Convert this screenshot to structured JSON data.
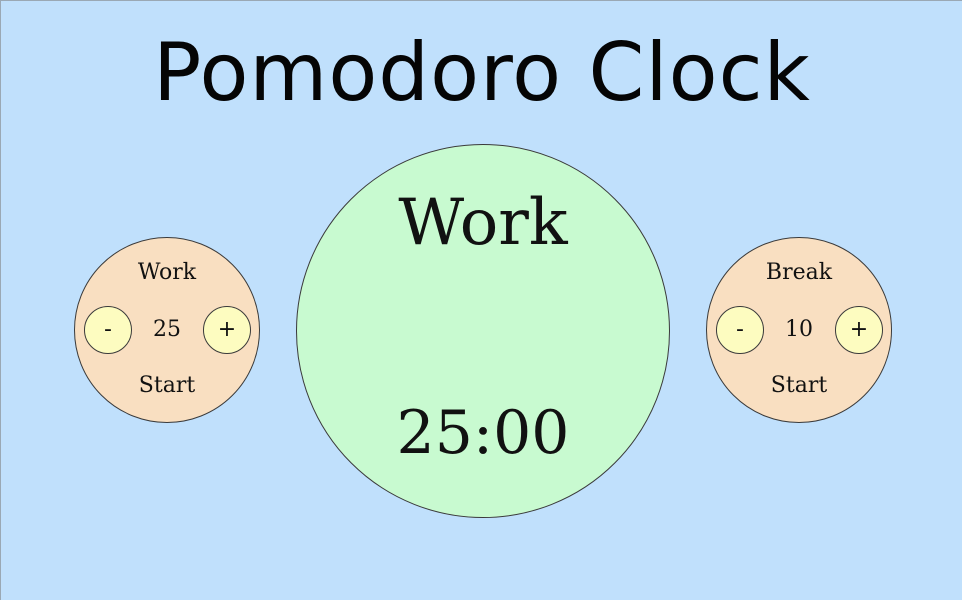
{
  "title": "Pomodoro Clock",
  "work": {
    "label": "Work",
    "value": "25",
    "minus": "-",
    "plus": "+",
    "start": "Start"
  },
  "break": {
    "label": "Break",
    "value": "10",
    "minus": "-",
    "plus": "+",
    "start": "Start"
  },
  "timer": {
    "session": "Work",
    "time": "25:00"
  },
  "colors": {
    "background": "#c0e0fc",
    "panel": "#f9dfc1",
    "timer": "#c8fad0",
    "button": "#fdfcc0"
  }
}
